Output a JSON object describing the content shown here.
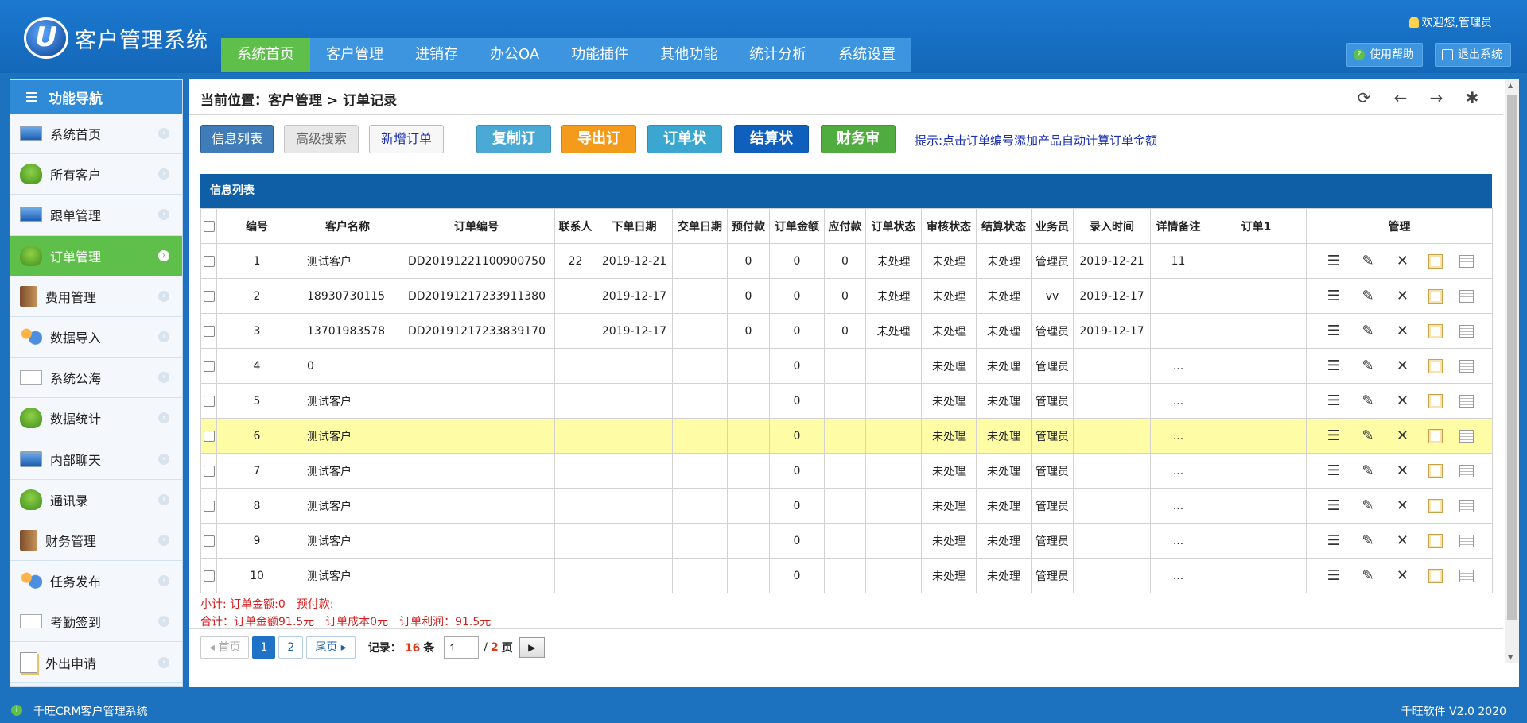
{
  "app": {
    "logo_text": "客户管理系统",
    "welcome": "欢迎您,管理员",
    "help_label": "使用帮助",
    "logout_label": "退出系统"
  },
  "nav": {
    "items": [
      "系统首页",
      "客户管理",
      "进销存",
      "办公OA",
      "功能插件",
      "其他功能",
      "统计分析",
      "系统设置"
    ]
  },
  "sidebar": {
    "title": "功能导航",
    "items": [
      {
        "label": "系统首页",
        "icon": "monitor-icon"
      },
      {
        "label": "所有客户",
        "icon": "tree-icon"
      },
      {
        "label": "跟单管理",
        "icon": "monitor-icon"
      },
      {
        "label": "订单管理",
        "icon": "tree-icon"
      },
      {
        "label": "费用管理",
        "icon": "book-icon"
      },
      {
        "label": "数据导入",
        "icon": "people-icon"
      },
      {
        "label": "系统公海",
        "icon": "mail-icon"
      },
      {
        "label": "数据统计",
        "icon": "tree-icon"
      },
      {
        "label": "内部聊天",
        "icon": "monitor-icon"
      },
      {
        "label": "通讯录",
        "icon": "tree-icon"
      },
      {
        "label": "财务管理",
        "icon": "book-icon"
      },
      {
        "label": "任务发布",
        "icon": "people-icon"
      },
      {
        "label": "考勤签到",
        "icon": "mail-icon"
      },
      {
        "label": "外出申请",
        "icon": "note-icon"
      }
    ]
  },
  "breadcrumb": "当前位置：客户管理 > 订单记录",
  "toolbar": {
    "list": "信息列表",
    "search": "高级搜索",
    "new_order": "新增订单",
    "copy": "复制订单",
    "export": "导出订单",
    "status": "订单状态",
    "settle": "结算状态",
    "audit": "财务审核",
    "hint": "提示:点击订单编号添加产品自动计算订单金额"
  },
  "table": {
    "title": "信息列表",
    "headers": [
      "编号",
      "客户名称",
      "订单编号",
      "联系人",
      "下单日期",
      "交单日期",
      "预付款",
      "订单金额",
      "应付款",
      "订单状态",
      "审核状态",
      "结算状态",
      "业务员",
      "录入时间",
      "详情备注",
      "订单1",
      "管理"
    ],
    "rows": [
      [
        "1",
        "测试客户",
        "DD20191221100900750",
        "22",
        "2019-12-21",
        "",
        "0",
        "0",
        "0",
        "未处理",
        "未处理",
        "未处理",
        "管理员",
        "2019-12-21",
        "11",
        ""
      ],
      [
        "2",
        "18930730115",
        "DD20191217233911380",
        "",
        "2019-12-17",
        "",
        "0",
        "0",
        "0",
        "未处理",
        "未处理",
        "未处理",
        "vv",
        "2019-12-17",
        "",
        ""
      ],
      [
        "3",
        "13701983578",
        "DD20191217233839170",
        "",
        "2019-12-17",
        "",
        "0",
        "0",
        "0",
        "未处理",
        "未处理",
        "未处理",
        "管理员",
        "2019-12-17",
        "",
        ""
      ],
      [
        "4",
        "0",
        "",
        "",
        "",
        "",
        "",
        "0",
        "",
        "",
        "未处理",
        "未处理",
        "管理员",
        "",
        "...",
        ""
      ],
      [
        "5",
        "测试客户",
        "",
        "",
        "",
        "",
        "",
        "0",
        "",
        "",
        "未处理",
        "未处理",
        "管理员",
        "",
        "...",
        ""
      ],
      [
        "6",
        "测试客户",
        "",
        "",
        "",
        "",
        "",
        "0",
        "",
        "",
        "未处理",
        "未处理",
        "管理员",
        "",
        "...",
        ""
      ],
      [
        "7",
        "测试客户",
        "",
        "",
        "",
        "",
        "",
        "0",
        "",
        "",
        "未处理",
        "未处理",
        "管理员",
        "",
        "...",
        ""
      ],
      [
        "8",
        "测试客户",
        "",
        "",
        "",
        "",
        "",
        "0",
        "",
        "",
        "未处理",
        "未处理",
        "管理员",
        "",
        "...",
        ""
      ],
      [
        "9",
        "测试客户",
        "",
        "",
        "",
        "",
        "",
        "0",
        "",
        "",
        "未处理",
        "未处理",
        "管理员",
        "",
        "...",
        ""
      ],
      [
        "10",
        "测试客户",
        "",
        "",
        "",
        "",
        "",
        "0",
        "",
        "",
        "未处理",
        "未处理",
        "管理员",
        "",
        "...",
        ""
      ]
    ],
    "highlighted_row": 5
  },
  "summary": {
    "subtotal_amount": "小计:  订单金额:0",
    "subtotal_prepay": "预付款:",
    "total_amount": "合计：订单金额91.5元",
    "total_cost": "订单成本0元",
    "total_profit": "订单利润：91.5元"
  },
  "pager": {
    "first": "◂ 首页",
    "page1": "1",
    "page2": "2",
    "last": "尾页 ▸",
    "records_label": "记录：",
    "records_count": "16",
    "records_unit": "条",
    "current_page": "1",
    "slash": "/",
    "total_pages": "2",
    "page_unit": "页"
  },
  "footer": {
    "left": "千旺CRM客户管理系统",
    "right": "千旺软件 V2.0 2020"
  },
  "colors": {
    "accent_green": "#5fbf4b",
    "header_blue": "#1467b8",
    "table_title": "#0f5fa6",
    "highlight_row": "#fefda5",
    "red_text": "#d21d1d"
  }
}
